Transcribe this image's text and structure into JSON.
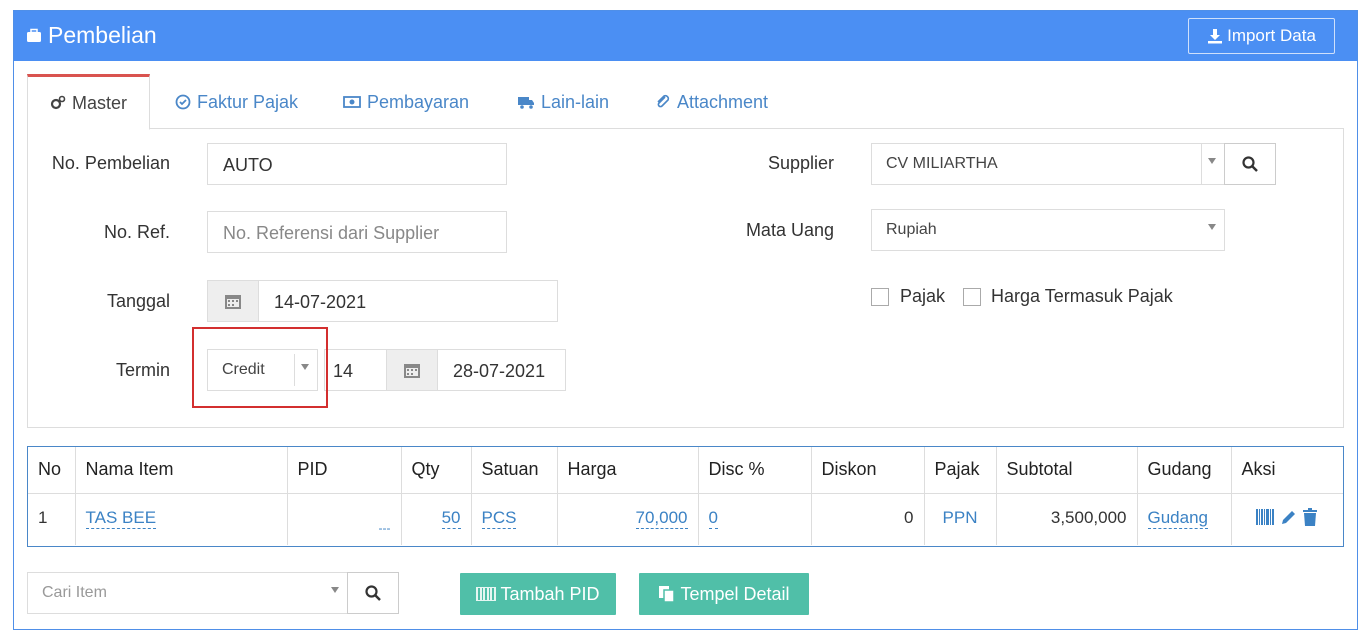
{
  "header": {
    "title": "Pembelian",
    "import_label": "Import Data",
    "accent": "#4b8ff3"
  },
  "tabs": [
    {
      "label": "Master",
      "icon": "cogs-icon",
      "active": true
    },
    {
      "label": "Faktur Pajak",
      "icon": "check-circle-icon"
    },
    {
      "label": "Pembayaran",
      "icon": "money-icon"
    },
    {
      "label": "Lain-lain",
      "icon": "truck-icon"
    },
    {
      "label": "Attachment",
      "icon": "paperclip-icon"
    }
  ],
  "form": {
    "no_pembelian": {
      "label": "No. Pembelian",
      "value": "AUTO"
    },
    "no_ref": {
      "label": "No. Ref.",
      "placeholder": "No. Referensi dari Supplier"
    },
    "tanggal": {
      "label": "Tanggal",
      "value": "14-07-2021"
    },
    "termin": {
      "label": "Termin",
      "type": "Credit",
      "days": "14",
      "due_date": "28-07-2021"
    },
    "supplier": {
      "label": "Supplier",
      "value": "CV MILIARTHA"
    },
    "mata_uang": {
      "label": "Mata Uang",
      "value": "Rupiah"
    },
    "pajak_label": "Pajak",
    "harga_termasuk_pajak_label": "Harga Termasuk Pajak"
  },
  "table": {
    "headers": [
      "No",
      "Nama Item",
      "PID",
      "Qty",
      "Satuan",
      "Harga",
      "Disc %",
      "Diskon",
      "Pajak",
      "Subtotal",
      "Gudang",
      "Aksi"
    ],
    "rows": [
      {
        "no": "1",
        "nama_item": "TAS BEE",
        "pid": "---",
        "qty": "50",
        "satuan": "PCS",
        "harga": "70,000",
        "disc": "0",
        "diskon": "0",
        "pajak": "PPN",
        "subtotal": "3,500,000",
        "gudang": "Gudang"
      }
    ]
  },
  "footer": {
    "search_placeholder": "Cari Item",
    "tambah_pid_label": "Tambah PID",
    "tempel_detail_label": "Tempel Detail"
  }
}
